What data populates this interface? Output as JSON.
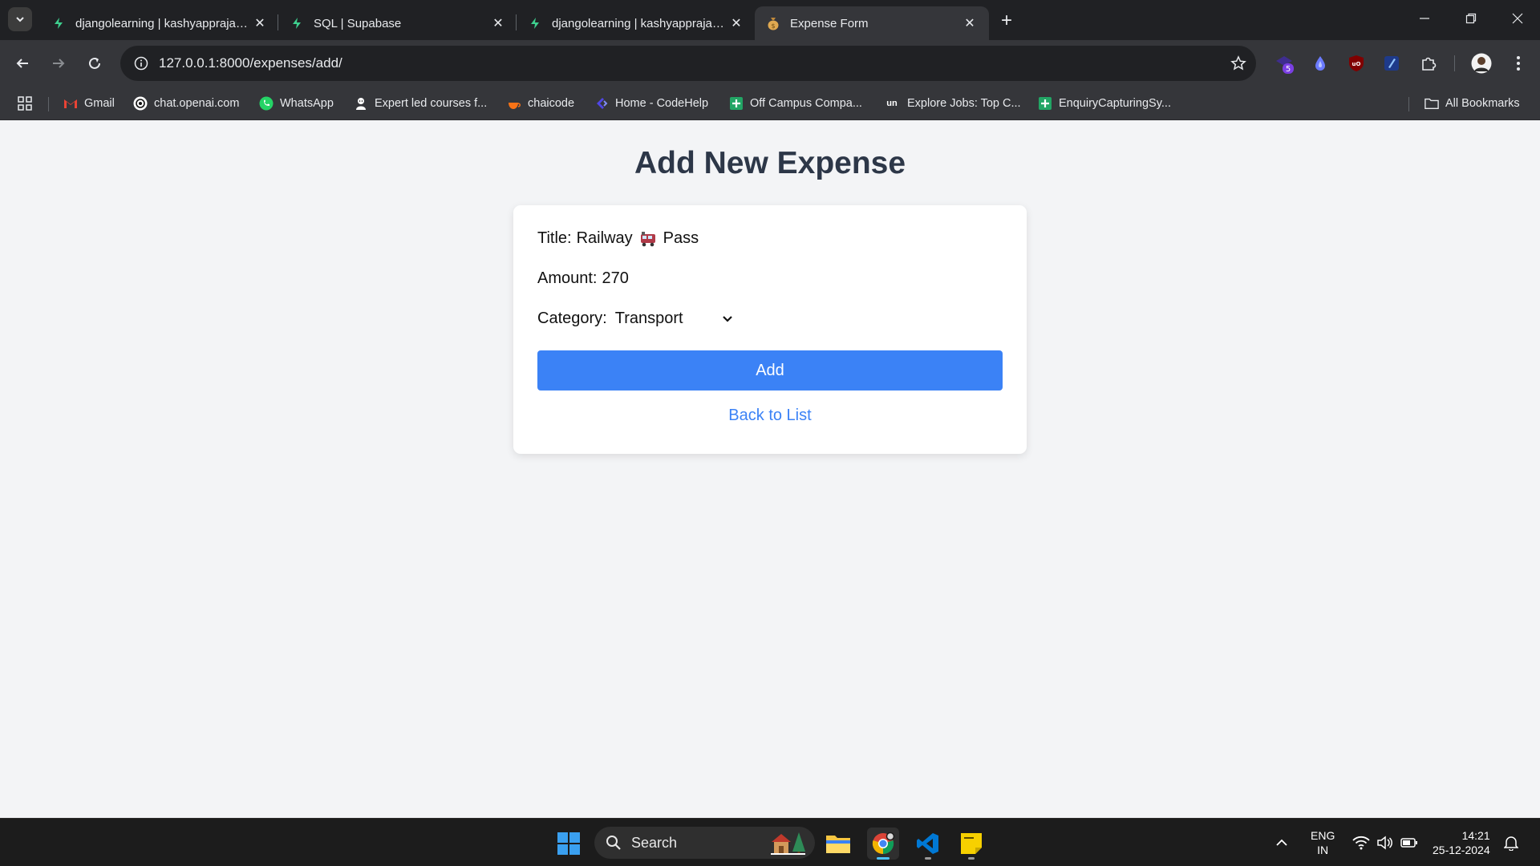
{
  "browser": {
    "tabs": [
      {
        "title": "djangolearning | kashyapprajapat",
        "active": false
      },
      {
        "title": "SQL | Supabase",
        "active": false
      },
      {
        "title": "djangolearning | kashyapprajapat",
        "active": false
      },
      {
        "title": "Expense Form",
        "active": true
      }
    ],
    "url": "127.0.0.1:8000/expenses/add/",
    "extension_badge": "5",
    "bookmarks": [
      {
        "label": "Gmail",
        "icon": "gmail-icon"
      },
      {
        "label": "chat.openai.com",
        "icon": "openai-icon"
      },
      {
        "label": "WhatsApp",
        "icon": "whatsapp-icon"
      },
      {
        "label": "Expert led courses f...",
        "icon": "course-icon"
      },
      {
        "label": "chaicode",
        "icon": "chaicode-icon"
      },
      {
        "label": "Home - CodeHelp",
        "icon": "codehelp-icon"
      },
      {
        "label": "Off Campus Compa...",
        "icon": "sheets-icon"
      },
      {
        "label": "Explore Jobs: Top C...",
        "icon": "unstop-icon"
      },
      {
        "label": "EnquiryCapturingSy...",
        "icon": "sheets-icon"
      }
    ],
    "all_bookmarks_label": "All Bookmarks"
  },
  "page": {
    "heading": "Add New Expense",
    "title_label": "Title:",
    "title_before_emoji": "Railway",
    "title_after_emoji": "Pass",
    "amount_label": "Amount:",
    "amount_value": "270",
    "category_label": "Category:",
    "category_value": "Transport",
    "add_button": "Add",
    "back_link": "Back to List"
  },
  "taskbar": {
    "search_label": "Search",
    "lang_line1": "ENG",
    "lang_line2": "IN",
    "time": "14:21",
    "date": "25-12-2024"
  },
  "colors": {
    "accent": "#3b82f6",
    "heading": "#2d3748",
    "page_bg": "#f3f4f6"
  }
}
